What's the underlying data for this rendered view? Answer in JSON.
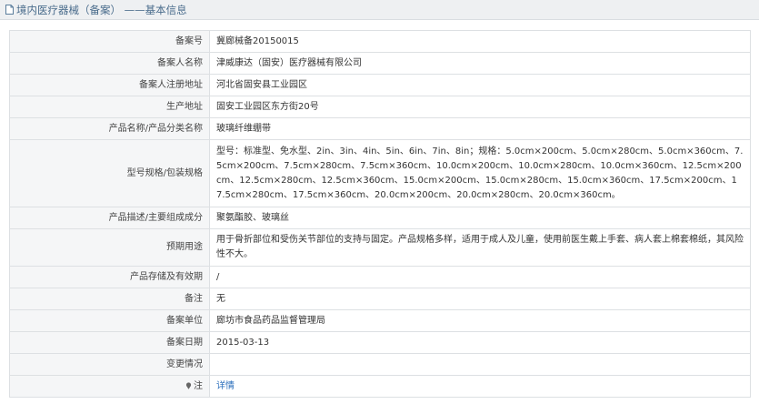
{
  "header": {
    "title": "境内医疗器械（备案） ——基本信息",
    "icon": "document-icon"
  },
  "rows": [
    {
      "label": "备案号",
      "value": "冀廊械备20150015"
    },
    {
      "label": "备案人名称",
      "value": "津威康达（固安）医疗器械有限公司"
    },
    {
      "label": "备案人注册地址",
      "value": "河北省固安县工业园区"
    },
    {
      "label": "生产地址",
      "value": "固安工业园区东方街20号"
    },
    {
      "label": "产品名称/产品分类名称",
      "value": "玻璃纤维绷带"
    },
    {
      "label": "型号规格/包装规格",
      "value": "型号：标准型、免水型、2in、3in、4in、5in、6in、7in、8in；规格：5.0cm×200cm、5.0cm×280cm、5.0cm×360cm、7.5cm×200cm、7.5cm×280cm、7.5cm×360cm、10.0cm×200cm、10.0cm×280cm、10.0cm×360cm、12.5cm×200cm、12.5cm×280cm、12.5cm×360cm、15.0cm×200cm、15.0cm×280cm、15.0cm×360cm、17.5cm×200cm、17.5cm×280cm、17.5cm×360cm、20.0cm×200cm、20.0cm×280cm、20.0cm×360cm。"
    },
    {
      "label": "产品描述/主要组成成分",
      "value": "聚氨酯胶、玻璃丝"
    },
    {
      "label": "预期用途",
      "value": "用于骨折部位和受伤关节部位的支持与固定。产品规格多样，适用于成人及儿童，使用前医生戴上手套、病人套上棉套棉纸，其风险性不大。"
    },
    {
      "label": "产品存储及有效期",
      "value": "/"
    },
    {
      "label": "备注",
      "value": "无"
    },
    {
      "label": "备案单位",
      "value": "廊坊市食品药品监督管理局"
    },
    {
      "label": "备案日期",
      "value": "2015-03-13"
    },
    {
      "label": "变更情况",
      "value": ""
    },
    {
      "label": "注",
      "value": "详情",
      "icon": "pin-icon"
    }
  ],
  "colors": {
    "header_bg": "#eef0f2",
    "header_text": "#4a6c8c",
    "label_bg": "#f5f6f7",
    "border": "#dde0e3",
    "link": "#2a6ebb"
  }
}
